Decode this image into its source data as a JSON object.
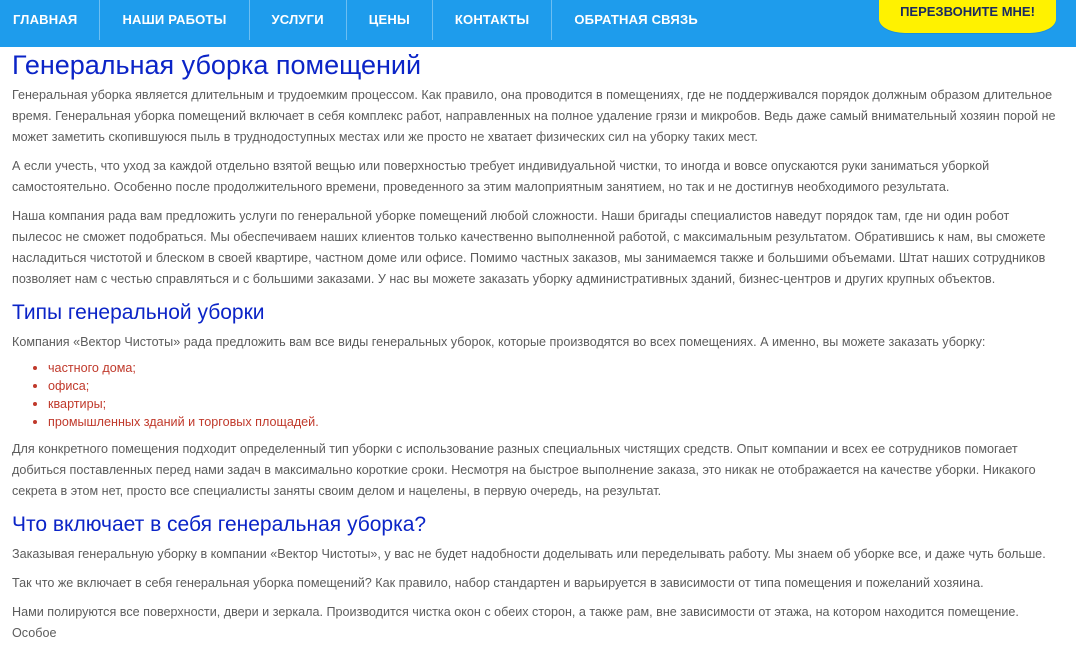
{
  "nav": {
    "items": [
      "ГЛАВНАЯ",
      "НАШИ РАБОТЫ",
      "УСЛУГИ",
      "ЦЕНЫ",
      "КОНТАКТЫ",
      "ОБРАТНАЯ СВЯЗЬ"
    ],
    "callback_label": "ПЕРЕЗВОНИТЕ МНЕ!",
    "bar_color": "#1e9cec",
    "callback_color": "#fff200"
  },
  "title": "Генеральная уборка помещений",
  "intro_paragraphs": [
    "Генеральная уборка является длительным и трудоемким процессом. Как правило, она проводится в помещениях, где не поддерживался порядок должным образом длительное время. Генеральная уборка помещений включает в себя комплекс работ, направленных на полное удаление грязи и микробов. Ведь даже самый внимательный хозяин порой не может заметить скопившуюся пыль в труднодоступных местах или же просто не хватает физических сил на уборку таких мест.",
    "А если учесть, что уход за каждой отдельно взятой вещью или поверхностью требует индивидуальной чистки, то иногда и вовсе опускаются руки заниматься уборкой самостоятельно. Особенно после продолжительного времени, проведенного за этим малоприятным занятием, но так и не достигнув необходимого результата.",
    "Наша компания рада вам предложить услуги по генеральной уборке помещений любой сложности. Наши бригады специалистов наведут порядок там, где ни один робот пылесос не сможет подобраться. Мы обеспечиваем наших клиентов только качественно выполненной работой, с максимальным результатом. Обратившись к нам, вы сможете насладиться чистотой и блеском в своей квартире, частном доме или офисе. Помимо частных заказов, мы занимаемся также и большими объемами. Штат наших сотрудников позволяет нам с честью справляться и с большими заказами. У нас вы можете заказать уборку административных зданий, бизнес-центров и других крупных объектов."
  ],
  "types_section": {
    "heading": "Типы генеральной уборки",
    "lead": "Компания «Вектор Чистоты» рада предложить вам все виды генеральных уборок, которые производятся во всех помещениях. А именно, вы можете заказать уборку:",
    "items": [
      "частного дома;",
      "офиса;",
      "квартиры;",
      "промышленных зданий и торговых площадей."
    ],
    "after": "Для конкретного помещения подходит определенный тип уборки с использование разных специальных чистящих средств. Опыт компании и всех ее сотрудников помогает добиться поставленных перед нами задач в максимально короткие сроки. Несмотря на быстрое выполнение заказа, это никак не отображается на качестве уборки. Никакого секрета в этом нет, просто все специалисты заняты своим делом и нацелены, в первую очередь, на результат."
  },
  "includes_section": {
    "heading": "Что включает в себя генеральная уборка?",
    "paragraphs": [
      "Заказывая генеральную уборку в компании «Вектор Чистоты», у вас не будет надобности доделывать или переделывать работу. Мы знаем об уборке все, и даже чуть больше.",
      "Так что же включает в себя генеральная уборка помещений? Как правило, набор стандартен и варьируется в зависимости от типа помещения и пожеланий хозяина.",
      "Нами полируются все поверхности, двери и зеркала. Производится чистка окон с обеих сторон, а также рам, вне зависимости от этажа, на котором находится помещение. Особое"
    ]
  }
}
